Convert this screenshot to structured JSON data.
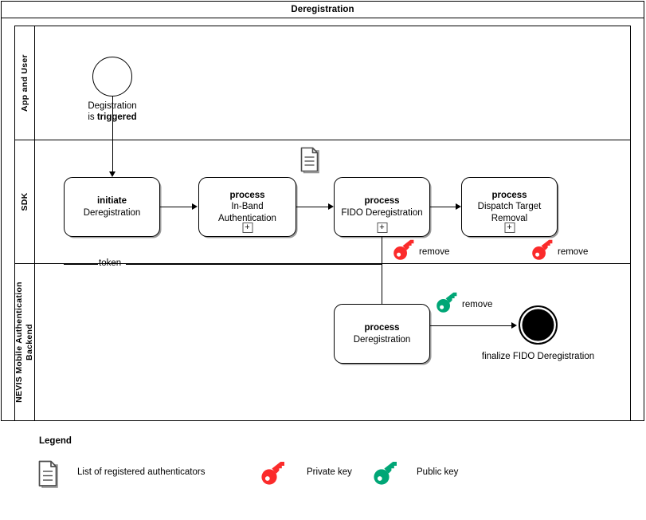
{
  "pool": {
    "title": "Deregistration"
  },
  "lanes": [
    {
      "id": "app-and-user",
      "label": "App and User"
    },
    {
      "id": "sdk",
      "label": "SDK"
    },
    {
      "id": "backend",
      "label": "NEVIS Mobile Authentication Backend"
    }
  ],
  "events": {
    "start": {
      "name": "start-event",
      "label_line1": "Degistration",
      "label_line2_prefix": "is ",
      "label_line2_strong": "triggered"
    },
    "end": {
      "name": "end-event",
      "label": "finalize FIDO Deregistration"
    }
  },
  "tasks": [
    {
      "id": "initiate-deregistration",
      "strong": "initiate",
      "rest": "Deregistration",
      "marker": ""
    },
    {
      "id": "process-in-band-authentication",
      "strong": "process",
      "rest": "In-Band\nAuthentication",
      "marker": "+"
    },
    {
      "id": "process-fido-deregistration",
      "strong": "process",
      "rest": "FIDO Deregistration",
      "marker": "+"
    },
    {
      "id": "process-dispatch-target-removal",
      "strong": "process",
      "rest": "Dispatch Target\nRemoval",
      "marker": "+"
    },
    {
      "id": "process-deregistration-backend",
      "strong": "process",
      "rest": "Deregistration",
      "marker": ""
    }
  ],
  "annotations": {
    "token": "token",
    "remove_fido": "remove",
    "remove_dispatch": "remove",
    "remove_backend": "remove"
  },
  "legend": {
    "title": "Legend",
    "items": [
      {
        "icon": "document-icon",
        "label": "List of registered authenticators"
      },
      {
        "icon": "key-icon-red",
        "label": "Private key"
      },
      {
        "icon": "key-icon-green",
        "label": "Public key"
      }
    ]
  },
  "colors": {
    "private_key": "#FB2B2B",
    "public_key": "#00A676",
    "stroke": "#000000",
    "doc_icon": "#4D4D4D"
  }
}
